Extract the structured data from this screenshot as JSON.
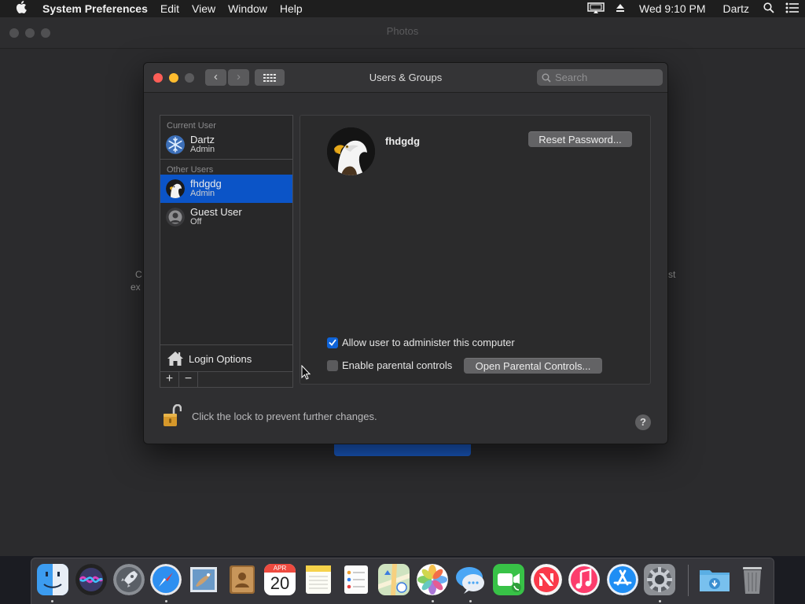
{
  "menubar": {
    "apple_icon": "apple-icon",
    "app_name": "System Preferences",
    "menus": [
      "Edit",
      "View",
      "Window",
      "Help"
    ],
    "clock": "Wed 9:10 PM",
    "user": "Dartz",
    "status_icons": [
      "airplay-icon",
      "eject-icon",
      "spotlight-icon",
      "notification-center-icon"
    ]
  },
  "background_window": {
    "title": "Photos",
    "fragments": {
      "left1": "C",
      "left2": "ex",
      "right1": "st"
    }
  },
  "prefs": {
    "title": "Users & Groups",
    "search_placeholder": "Search",
    "nav": {
      "back": "‹",
      "forward": "›"
    },
    "sections": {
      "current": "Current User",
      "other": "Other Users"
    },
    "current_user": {
      "name": "Dartz",
      "role": "Admin"
    },
    "other_users": [
      {
        "name": "fhdgdg",
        "role": "Admin",
        "selected": true
      },
      {
        "name": "Guest User",
        "role": "Off",
        "selected": false
      }
    ],
    "login_options": "Login Options",
    "add_label": "+",
    "remove_label": "−",
    "detail": {
      "name": "fhdgdg",
      "reset_password": "Reset Password...",
      "admin_label": "Allow user to administer this computer",
      "admin_checked": true,
      "parental_label": "Enable parental controls",
      "parental_checked": false,
      "open_parental": "Open Parental Controls..."
    },
    "lock_text": "Click the lock to prevent further changes.",
    "help": "?"
  },
  "dock": {
    "apps": [
      {
        "name": "Finder",
        "icon": "finder-icon",
        "running": true
      },
      {
        "name": "Siri",
        "icon": "siri-icon",
        "running": false
      },
      {
        "name": "Launchpad",
        "icon": "launchpad-icon",
        "running": false
      },
      {
        "name": "Safari",
        "icon": "safari-icon",
        "running": true
      },
      {
        "name": "Mail",
        "icon": "mail-icon",
        "running": false
      },
      {
        "name": "Contacts",
        "icon": "contacts-icon",
        "running": false
      },
      {
        "name": "Calendar",
        "icon": "calendar-icon",
        "running": false,
        "month": "APR",
        "day": "20"
      },
      {
        "name": "Notes",
        "icon": "notes-icon",
        "running": false
      },
      {
        "name": "Reminders",
        "icon": "reminders-icon",
        "running": false
      },
      {
        "name": "Maps",
        "icon": "maps-icon",
        "running": false
      },
      {
        "name": "Photos",
        "icon": "photos-icon",
        "running": true
      },
      {
        "name": "Messages",
        "icon": "messages-icon",
        "running": true
      },
      {
        "name": "FaceTime",
        "icon": "facetime-icon",
        "running": false
      },
      {
        "name": "News",
        "icon": "news-icon",
        "running": false
      },
      {
        "name": "iTunes",
        "icon": "itunes-icon",
        "running": false
      },
      {
        "name": "App Store",
        "icon": "app-store-icon",
        "running": false
      },
      {
        "name": "System Preferences",
        "icon": "system-preferences-icon",
        "running": true
      }
    ],
    "folders": [
      {
        "name": "Downloads",
        "icon": "downloads-folder-icon"
      },
      {
        "name": "Trash",
        "icon": "trash-icon"
      }
    ]
  }
}
